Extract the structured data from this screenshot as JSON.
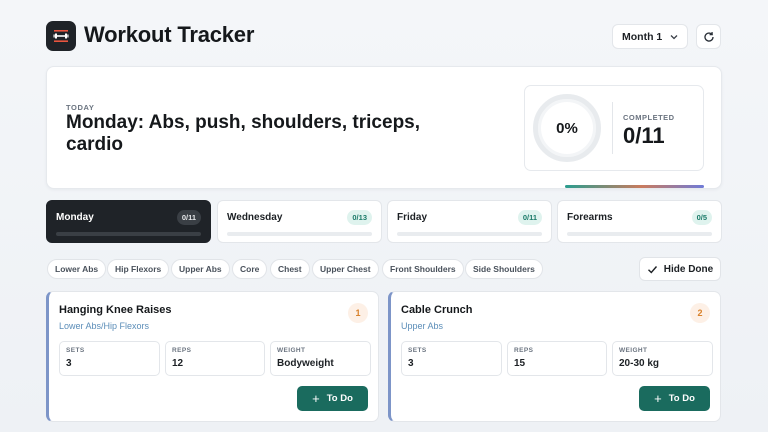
{
  "header": {
    "title": "Workout Tracker",
    "month_select": "Month 1",
    "icons": {
      "logo": "dumbbell-icon",
      "chevron": "chevron-down-icon",
      "refresh": "refresh-icon"
    }
  },
  "today": {
    "label": "TODAY",
    "title": "Monday: Abs, push, shoulders, triceps, cardio",
    "progress_percent": "0%",
    "completed_label": "COMPLETED",
    "completed_value": "0/11"
  },
  "days": [
    {
      "name": "Monday",
      "count": "0/11",
      "active": true
    },
    {
      "name": "Wednesday",
      "count": "0/13",
      "active": false
    },
    {
      "name": "Friday",
      "count": "0/11",
      "active": false
    },
    {
      "name": "Forearms",
      "count": "0/5",
      "active": false
    }
  ],
  "filters": [
    "Lower Abs",
    "Hip Flexors",
    "Upper Abs",
    "Core",
    "Chest",
    "Upper Chest",
    "Front Shoulders",
    "Side Shoulders"
  ],
  "hide_done_label": "Hide Done",
  "stat_labels": {
    "sets": "SETS",
    "reps": "REPS",
    "weight": "WEIGHT"
  },
  "todo_label": "To Do",
  "exercises": [
    {
      "number": "1",
      "name": "Hanging Knee Raises",
      "muscle": "Lower Abs/Hip Flexors",
      "sets": "3",
      "reps": "12",
      "weight": "Bodyweight"
    },
    {
      "number": "2",
      "name": "Cable Crunch",
      "muscle": "Upper Abs",
      "sets": "3",
      "reps": "15",
      "weight": "20-30 kg"
    }
  ],
  "colors": {
    "accent": "#1a6b5e",
    "dark": "#1f2328",
    "badge_bg": "#dff3ee",
    "number_orange": "#d9822b"
  }
}
